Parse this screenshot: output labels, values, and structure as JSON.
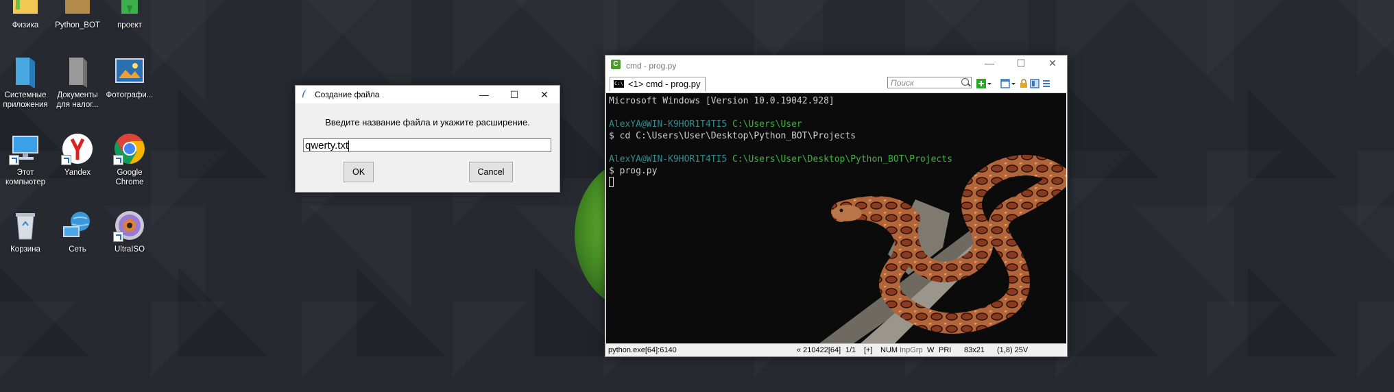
{
  "desktop": {
    "icons": [
      {
        "label": "Физика",
        "icon": "folder-icon"
      },
      {
        "label": "Python_BOT",
        "icon": "folder-icon"
      },
      {
        "label": "проект",
        "icon": "folder-icon"
      },
      {
        "label": "Системные приложения",
        "icon": "folder-icon"
      },
      {
        "label": "Документы для налог...",
        "icon": "folder-icon"
      },
      {
        "label": "Фотографи...",
        "icon": "photos-icon"
      },
      {
        "label": "Этот компьютер",
        "icon": "computer-icon"
      },
      {
        "label": "Yandex",
        "icon": "yandex-icon"
      },
      {
        "label": "Google Chrome",
        "icon": "chrome-icon"
      },
      {
        "label": "Корзина",
        "icon": "recycle-bin-icon"
      },
      {
        "label": "Сеть",
        "icon": "network-icon"
      },
      {
        "label": "UltraISO",
        "icon": "ultraiso-icon"
      }
    ]
  },
  "dialog": {
    "title": "Создание файла",
    "prompt": "Введите название файла и укажите расширение.",
    "input_value": "qwerty.txt",
    "ok_label": "OK",
    "cancel_label": "Cancel"
  },
  "console": {
    "title": "cmd - prog.py",
    "tab_label": "<1> cmd - prog.py",
    "search_placeholder": "Поиск",
    "lines": [
      {
        "text": "Microsoft Windows [Version 10.0.19042.928]",
        "color": "#cfcfcf"
      },
      {
        "text": "",
        "color": "#cfcfcf"
      },
      {
        "user": "AlexYA@WIN-K9HOR1T4TI5",
        "path": "C:\\Users\\User"
      },
      {
        "text": "$ cd C:\\Users\\User\\Desktop\\Python_BOT\\Projects",
        "color": "#cfcfcf"
      },
      {
        "text": "",
        "color": "#cfcfcf"
      },
      {
        "user": "AlexYA@WIN-K9HOR1T4TI5",
        "path": "C:\\Users\\User\\Desktop\\Python_BOT\\Projects"
      },
      {
        "text": "$ prog.py",
        "color": "#cfcfcf"
      }
    ],
    "colors": {
      "user": "#2f8f8f",
      "path": "#3db33d"
    },
    "status": {
      "process": "python.exe[64]:6140",
      "pid": "« 210422[64]",
      "page": "1/1",
      "plus": "[+]",
      "num": "NUM",
      "inpgrp": "InpGrp",
      "w": "W",
      "pri": "PRI",
      "size": "83x21",
      "pos": "(1,8) 25V"
    }
  }
}
